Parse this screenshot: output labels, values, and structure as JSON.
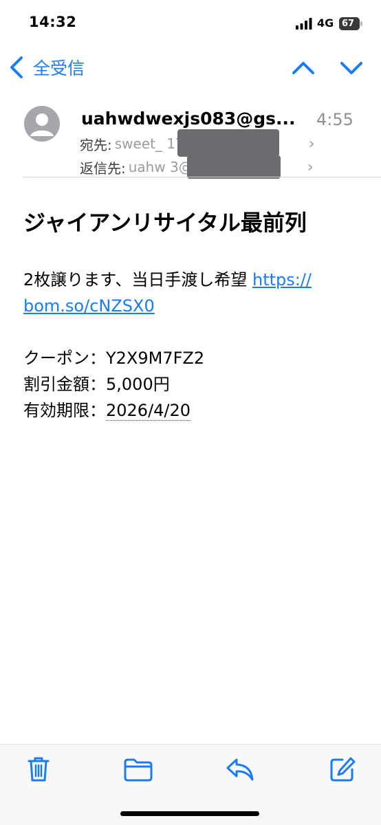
{
  "status_bar": {
    "time": "14:32",
    "network": "4G",
    "battery": "67"
  },
  "nav": {
    "back_label": "全受信",
    "accent": "#1a7cf5",
    "icons": [
      "chevron-left-icon",
      "chevron-up-icon",
      "chevron-down-icon"
    ]
  },
  "header": {
    "sender": "uahwdwexjs083@gs...",
    "time": "4:55",
    "to_label": "宛先:",
    "to_value": "sweet_          177...",
    "reply_label": "返信先:",
    "reply_value": "uahw              3@..."
  },
  "message": {
    "subject": "ジャイアンリサイタル最前列",
    "line1_text": "2枚譲ります、当日手渡し希望 ",
    "link_part1": "https://",
    "link_part2": "bom.so/cNZSX0",
    "coupon_label": "クーポン：",
    "coupon_value": "Y2X9M7FZ2",
    "discount_label": "割引金額：",
    "discount_value": "5,000円",
    "expiry_label": "有効期限：",
    "expiry_value": "2026/4/20"
  },
  "toolbar": {
    "icons": [
      "trash-icon",
      "folder-icon",
      "reply-icon",
      "compose-icon"
    ]
  }
}
